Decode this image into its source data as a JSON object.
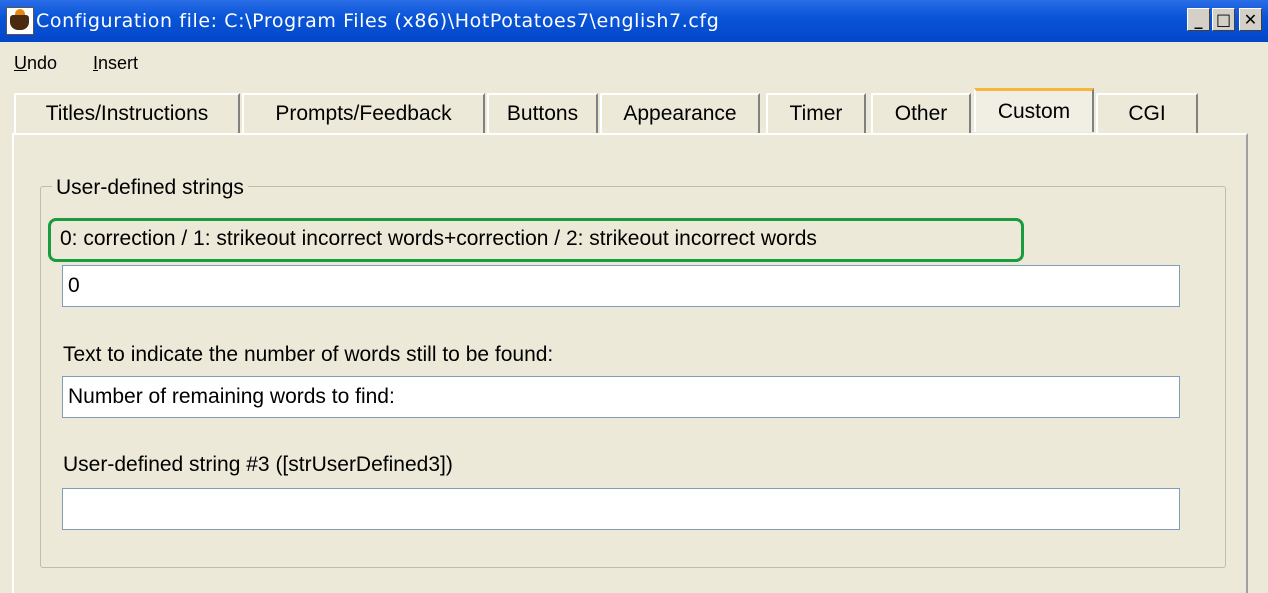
{
  "window": {
    "title": "Configuration file: C:\\Program Files (x86)\\HotPotatoes7\\english7.cfg",
    "icon": "hot-potatoes-app-icon",
    "controls": {
      "minimize": "_",
      "maximize": "□",
      "close": "✕"
    }
  },
  "menu": {
    "undo": {
      "accel": "U",
      "rest": "ndo"
    },
    "insert": {
      "accel": "I",
      "rest": "nsert"
    }
  },
  "tabs": [
    {
      "label": "Titles/Instructions",
      "active": false
    },
    {
      "label": "Prompts/Feedback",
      "active": false
    },
    {
      "label": "Buttons",
      "active": false
    },
    {
      "label": "Appearance",
      "active": false
    },
    {
      "label": "Timer",
      "active": false
    },
    {
      "label": "Other",
      "active": false
    },
    {
      "label": "Custom",
      "active": true
    },
    {
      "label": "CGI",
      "active": false
    }
  ],
  "custom": {
    "group_title": "User-defined strings",
    "fields": [
      {
        "label": "0: correction / 1: strikeout incorrect words+correction / 2: strikeout incorrect words",
        "value": "0"
      },
      {
        "label": "Text to indicate the number of words still to be found:",
        "value": "Number of remaining words to find:"
      },
      {
        "label": "User-defined string #3 ([strUserDefined3])",
        "value": ""
      }
    ]
  },
  "colors": {
    "titlebar": "#0a55d8",
    "active_tab_accent": "#f7b63a",
    "highlight_outline": "#1a9b3f",
    "window_bg": "#ece9d8"
  }
}
